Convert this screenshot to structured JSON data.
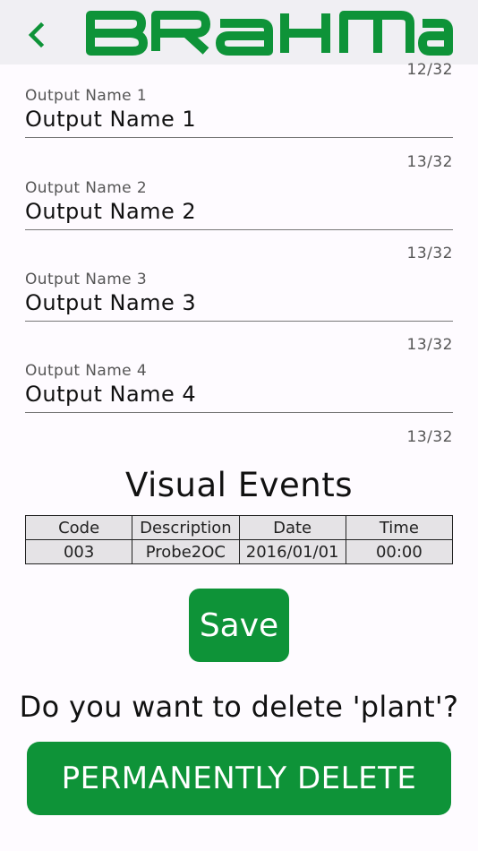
{
  "header": {
    "logo_text": "BRAHMA",
    "brand_color": "#0e9338",
    "back_icon": "chevron-left-icon"
  },
  "fields": [
    {
      "counter": "12/32",
      "label": "Output Name 1",
      "value": "Output Name 1"
    },
    {
      "counter": "13/32",
      "label": "Output Name 2",
      "value": "Output Name 2"
    },
    {
      "counter": "13/32",
      "label": "Output Name 3",
      "value": "Output Name 3"
    },
    {
      "counter": "13/32",
      "label": "Output Name 4",
      "value": "Output Name 4"
    }
  ],
  "last_counter": "13/32",
  "visual_events": {
    "title": "Visual Events",
    "columns": [
      "Code",
      "Description",
      "Date",
      "Time"
    ],
    "rows": [
      [
        "003",
        "Probe2OC",
        "2016/01/01",
        "00:00"
      ]
    ]
  },
  "save_label": "Save",
  "delete_question": "Do you want to delete 'plant'?",
  "delete_label": "PERMANENTLY DELETE"
}
